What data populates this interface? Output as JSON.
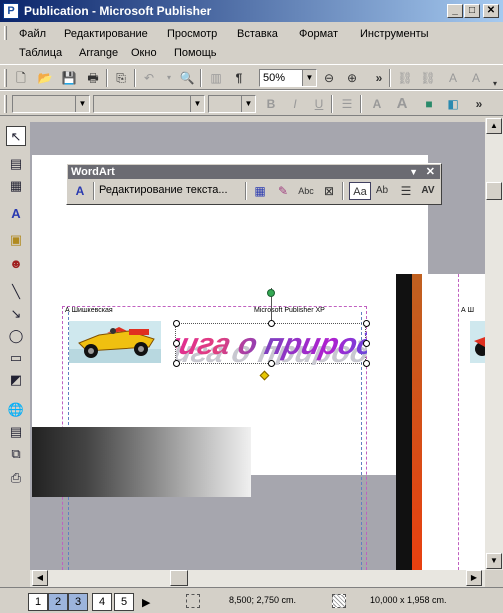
{
  "window": {
    "title": "Publication - Microsoft Publisher",
    "app_icon": "publisher-icon"
  },
  "menu": [
    "Файл",
    "Редактирование",
    "Просмотр",
    "Вставка",
    "Формат",
    "Инструменты",
    "Таблица",
    "Arrange",
    "Окно",
    "Помощь"
  ],
  "standard_toolbar": {
    "zoom_value": "50%"
  },
  "wordart_toolbar": {
    "title": "WordArt",
    "edit_text_label": "Редактирование текста..."
  },
  "document": {
    "header_left": "А  Шишкевская",
    "header_right": "Microsoft Publisher XP",
    "wordart_text": "Книга о природе",
    "page2_header": "А  Ш"
  },
  "status": {
    "pages": [
      "1",
      "2",
      "3",
      "4",
      "5"
    ],
    "selected_pages": [
      "2",
      "3"
    ],
    "position": "8,500; 2,750 cm.",
    "size": "10,000 x  1,958 cm."
  },
  "colors": {
    "title_start": "#0a246a",
    "title_end": "#a6caf0",
    "workspace": "#a6a6ae",
    "handle": "#34a853",
    "diamond": "#e8c800"
  }
}
